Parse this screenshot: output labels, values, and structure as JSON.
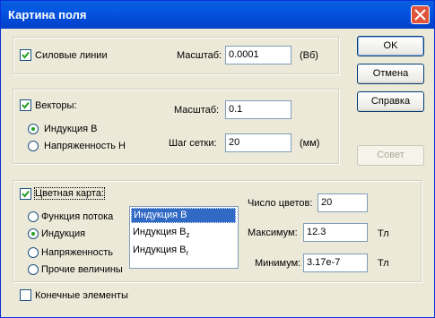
{
  "window": {
    "title": "Картина поля"
  },
  "field_lines": {
    "checkbox_label": "Силовые линии",
    "scale_label": "Масштаб:",
    "scale_value": "0.0001",
    "unit": "(Вб)"
  },
  "vectors": {
    "checkbox_label": "Векторы:",
    "radio_induction": "Индукция B",
    "radio_strength": "Напряженность H",
    "scale_label": "Масштаб:",
    "scale_value": "0.1",
    "grid_label": "Шаг сетки:",
    "grid_value": "20",
    "unit": "(мм)"
  },
  "color_map": {
    "checkbox_label": "Цветная карта:",
    "radio_flux": "Функция потока",
    "radio_induction": "Индукция",
    "radio_strength": "Напряженность",
    "radio_other": "Прочие величины",
    "list": [
      {
        "main": "Индукция B",
        "sub": ""
      },
      {
        "main": "Индукция B",
        "sub": "z"
      },
      {
        "main": "Индукция B",
        "sub": "r"
      }
    ],
    "num_colors_label": "Число цветов:",
    "num_colors_value": "20",
    "max_label": "Максимум:",
    "max_value": "12.3",
    "max_unit": "Тл",
    "min_label": "Минимум:",
    "min_value": "3.17e-7",
    "min_unit": "Тл"
  },
  "finite_elements": {
    "checkbox_label": "Конечные элементы"
  },
  "buttons": {
    "ok": "OK",
    "cancel": "Отмена",
    "help": "Справка",
    "advice": "Совет"
  }
}
